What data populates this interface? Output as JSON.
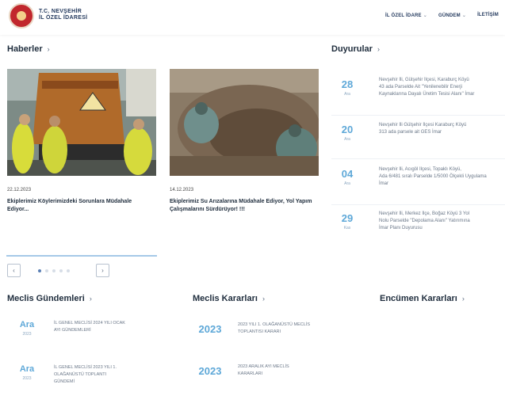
{
  "header": {
    "brand_line1": "T.C. NEVŞEHİR",
    "brand_line2": "İL ÖZEL İDARESİ",
    "nav": [
      {
        "label": "İL ÖZEL İDARE",
        "has_dropdown": true
      },
      {
        "label": "GÜNDEM",
        "has_dropdown": true
      },
      {
        "label": "İLETİŞİM",
        "has_dropdown": false
      }
    ]
  },
  "news": {
    "title": "Haberler",
    "arrow": "›",
    "items": [
      {
        "date": "22.12.2023",
        "title": "Ekiplerimiz Köylerimizdeki Sorunlara Müdahale Ediyor..."
      },
      {
        "date": "14.12.2023",
        "title": "Ekiplerimiz Su Arızalarına Müdahale Ediyor, Yol Yapım Çalışmalarını Sürdürüyor! !!!"
      }
    ],
    "prev": "‹",
    "next": "›"
  },
  "announcements": {
    "title": "Duyurular",
    "arrow": "›",
    "items": [
      {
        "day": "28",
        "month": "Ara",
        "text_lines": [
          "Nevşehir İli, Gülşehir İlçesi, Karaburç Köyü",
          "43 ada Parselde Ait \"Yenilenebilir Enerji",
          "Kaynaklarına Dayalı Üretim Tesisi Alanı\" İmar"
        ]
      },
      {
        "day": "20",
        "month": "Ara",
        "text_lines": [
          "Nevşehir İli Gülşehir İlçesi Karaburç Köyü",
          "313 ada parsele ait GES İmar"
        ]
      },
      {
        "day": "04",
        "month": "Ara",
        "text_lines": [
          "Nevşehir İli, Acıgöl İlçesi, Topaklı Köyü,",
          "Ada 6/481 sıralı Parselde 1/5000 Ölçekli Uygulama",
          "İmar"
        ]
      },
      {
        "day": "29",
        "month": "Kas",
        "text_lines": [
          "Nevşehir İli, Merkez İlçe, Boğaz Köyü 3 Yol",
          "Nolu Parselde \"Depolama Alanı\" Yatırımına",
          "İmar Planı Duyurusu"
        ]
      }
    ]
  },
  "meclis_gundemleri": {
    "title": "Meclis Gündemleri",
    "arrow": "›",
    "items": [
      {
        "date": "Ara",
        "sub": "2023",
        "text_lines": [
          "İL GENEL MECLİSİ 2024 YILI OCAK",
          "AYI GÜNDEMLERİ"
        ]
      },
      {
        "date": "Ara",
        "sub": "2023",
        "text_lines": [
          "İL GENEL MECLİSİ 2023 YILI 1.",
          "OLAĞANÜSTÜ TOPLANTI",
          "GÜNDEMİ"
        ]
      }
    ]
  },
  "meclis_kararlari": {
    "title": "Meclis Kararları",
    "arrow": "›",
    "items": [
      {
        "year": "2023",
        "text_lines": [
          "2023 YILI 1. OLAĞANÜSTÜ MECLİS",
          "TOPLANTISI KARARI"
        ]
      },
      {
        "year": "2023",
        "text_lines": [
          "2023 ARALIK AYI MECLİS",
          "KARARLARI"
        ]
      }
    ]
  },
  "encumen_kararlari": {
    "title": "Encümen Kararları",
    "arrow": "›"
  },
  "colors": {
    "accent": "#5ea8d8",
    "dark": "#1f2d3d",
    "brand_red": "#c1272d"
  }
}
